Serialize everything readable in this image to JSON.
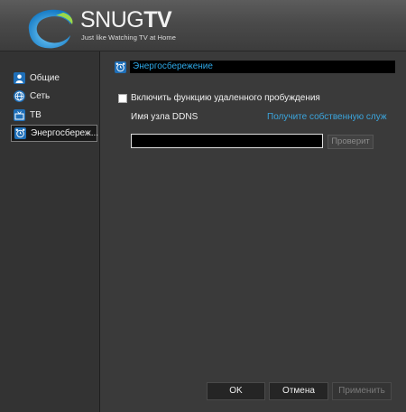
{
  "header": {
    "brand_light": "SNUG",
    "brand_bold": "TV",
    "tagline": "Just like Watching TV at Home"
  },
  "sidebar": {
    "items": [
      {
        "label": "Общие",
        "icon": "user-icon",
        "active": false
      },
      {
        "label": "Сеть",
        "icon": "globe-icon",
        "active": false
      },
      {
        "label": "ТВ",
        "icon": "tv-icon",
        "active": false
      },
      {
        "label": "Энергосбереж...",
        "icon": "alarm-clock-icon",
        "active": true
      }
    ]
  },
  "main": {
    "section_title": "Энергосбережение",
    "wake_checkbox_label": "Включить функцию удаленного пробуждения",
    "wake_checkbox_checked": false,
    "ddns_label": "Имя узла DDNS",
    "ddns_link": "Получите собственную служ",
    "ddns_value": "",
    "verify_button": "Проверит"
  },
  "footer": {
    "ok": "OK",
    "cancel": "Отмена",
    "apply": "Применить"
  },
  "colors": {
    "accent": "#2ea8e6",
    "link": "#3ba5dd",
    "icon_blue": "#1f6fb8",
    "background": "#3a3a3a"
  }
}
